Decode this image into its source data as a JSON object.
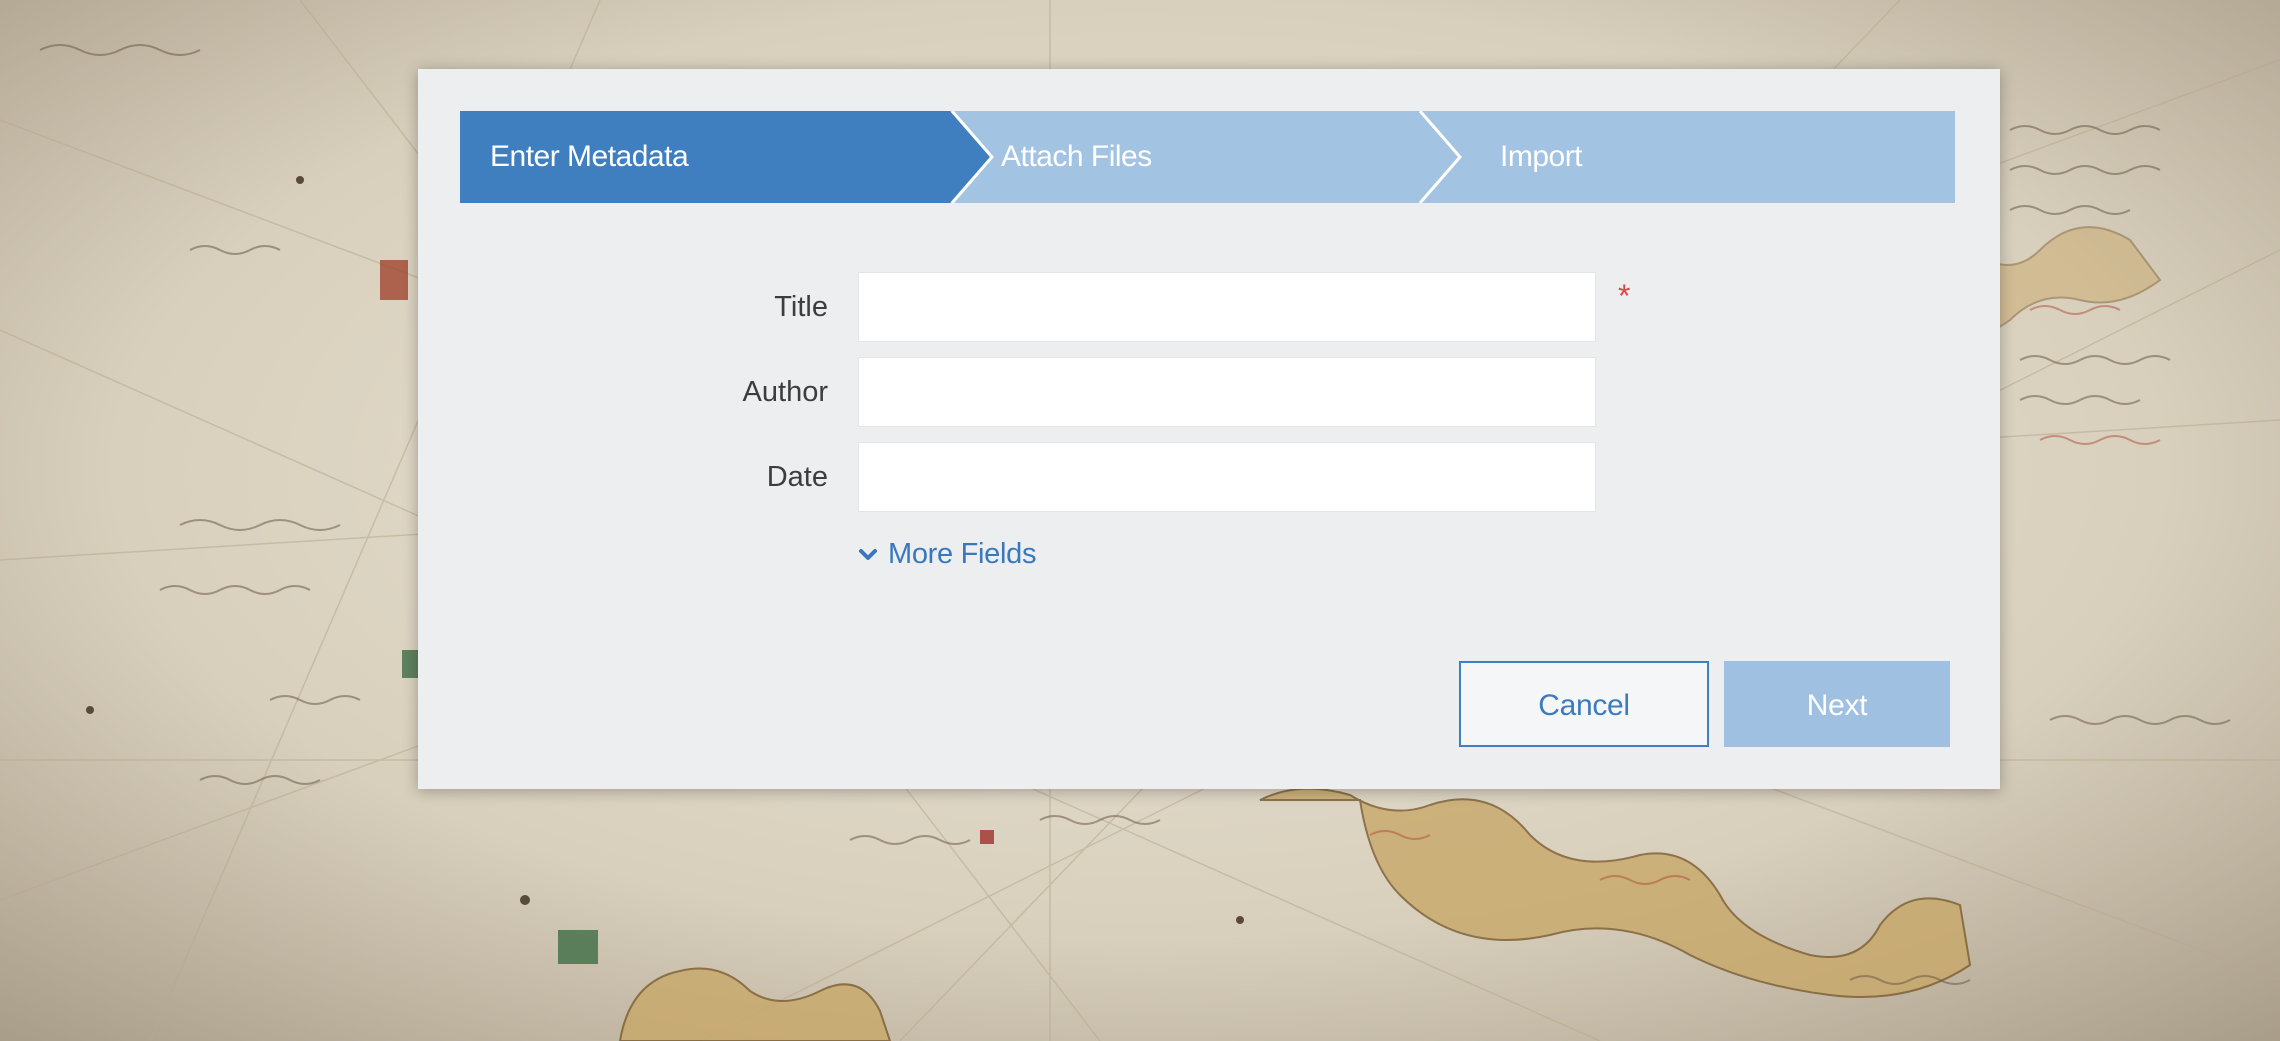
{
  "wizard": {
    "steps": [
      {
        "label": "Enter Metadata",
        "state": "active"
      },
      {
        "label": "Attach Files",
        "state": "inactive"
      },
      {
        "label": "Import",
        "state": "inactive"
      }
    ],
    "colors": {
      "active_step": "#3f7fc0",
      "inactive_step": "#a3c3e3",
      "link": "#3a78bd",
      "required": "#d24b4b"
    }
  },
  "form": {
    "title": {
      "label": "Title",
      "value": "",
      "placeholder": "",
      "required_mark": "*"
    },
    "author": {
      "label": "Author",
      "value": "",
      "placeholder": ""
    },
    "date": {
      "label": "Date",
      "value": "",
      "placeholder": ""
    },
    "more_fields": {
      "label": "More Fields",
      "icon": "chevron-down-icon"
    }
  },
  "actions": {
    "cancel_label": "Cancel",
    "next_label": "Next"
  }
}
